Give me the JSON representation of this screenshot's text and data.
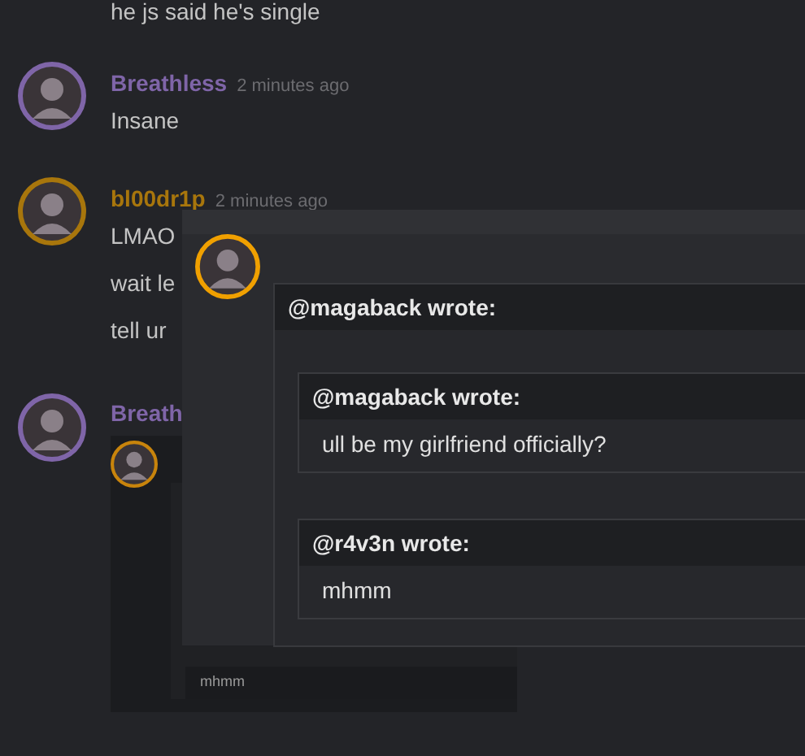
{
  "messages": [
    {
      "kind": "continuation",
      "lines": [
        "he js said he's single"
      ]
    },
    {
      "kind": "message",
      "author": "Breathless",
      "color": "#7f65a8",
      "time": "2 minutes ago",
      "lines": [
        "Insane"
      ]
    },
    {
      "kind": "message",
      "author": "bl00dr1p",
      "color": "#a8760c",
      "time": "2 minutes ago",
      "lines": [
        "LMAO",
        "wait le",
        "tell ur"
      ]
    },
    {
      "kind": "embed",
      "author": "Breath",
      "color": "#7f65a8",
      "embed_text": "mhmm"
    }
  ],
  "overlay": {
    "quote": {
      "author_line": "@magaback wrote:",
      "quotes": [
        {
          "author_line": "@magaback wrote:",
          "text": "ull be my girlfriend officially?"
        },
        {
          "author_line": "@r4v3n wrote:",
          "text": "mhmm"
        }
      ]
    }
  }
}
